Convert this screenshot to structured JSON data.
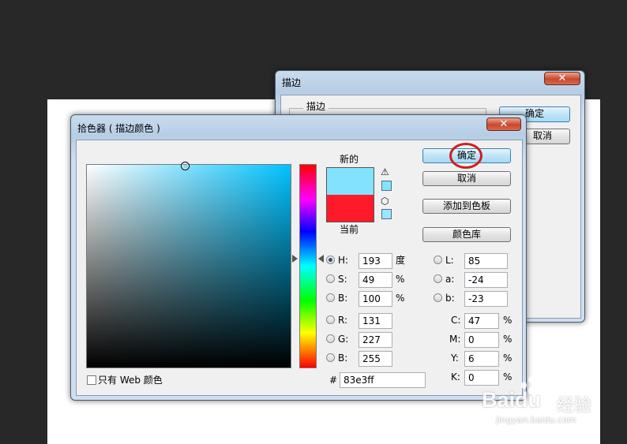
{
  "background_window": {
    "title": "描边",
    "close_glyph": "✕",
    "group_label": "描边",
    "ok_label": "确定",
    "cancel_label": "取消"
  },
  "dialog": {
    "title": "拾色器 ( 描边颜色 )",
    "close_glyph": "✕",
    "new_label": "新的",
    "current_label": "当前",
    "new_color": "#83e3ff",
    "current_color": "#ff1a2a",
    "hue_color": "#00c2ff",
    "buttons": {
      "ok": "确定",
      "cancel": "取消",
      "add_to_swatches": "添加到色板",
      "color_libraries": "颜色库"
    },
    "hsb": [
      {
        "label": "H:",
        "value": "193",
        "unit": "度",
        "selected": true
      },
      {
        "label": "S:",
        "value": "49",
        "unit": "%",
        "selected": false
      },
      {
        "label": "B:",
        "value": "100",
        "unit": "%",
        "selected": false
      }
    ],
    "rgb": [
      {
        "label": "R:",
        "value": "131"
      },
      {
        "label": "G:",
        "value": "227"
      },
      {
        "label": "B:",
        "value": "255"
      }
    ],
    "lab": [
      {
        "label": "L:",
        "value": "85"
      },
      {
        "label": "a:",
        "value": "-24"
      },
      {
        "label": "b:",
        "value": "-23"
      }
    ],
    "cmyk": [
      {
        "label": "C:",
        "value": "47",
        "unit": "%"
      },
      {
        "label": "M:",
        "value": "0",
        "unit": "%"
      },
      {
        "label": "Y:",
        "value": "6",
        "unit": "%"
      },
      {
        "label": "K:",
        "value": "0",
        "unit": "%"
      }
    ],
    "hex_label": "#",
    "hex_value": "83e3ff",
    "web_only_label": "只有 Web 颜色",
    "web_only_checked": false,
    "warning_glyph": "⚠",
    "cube_glyph": "⬡"
  },
  "watermark": {
    "brand": "Baidu",
    "brand_cn": "经验",
    "url": "jingyan.baidu.com"
  },
  "highlight_color": "#cc1f1f"
}
